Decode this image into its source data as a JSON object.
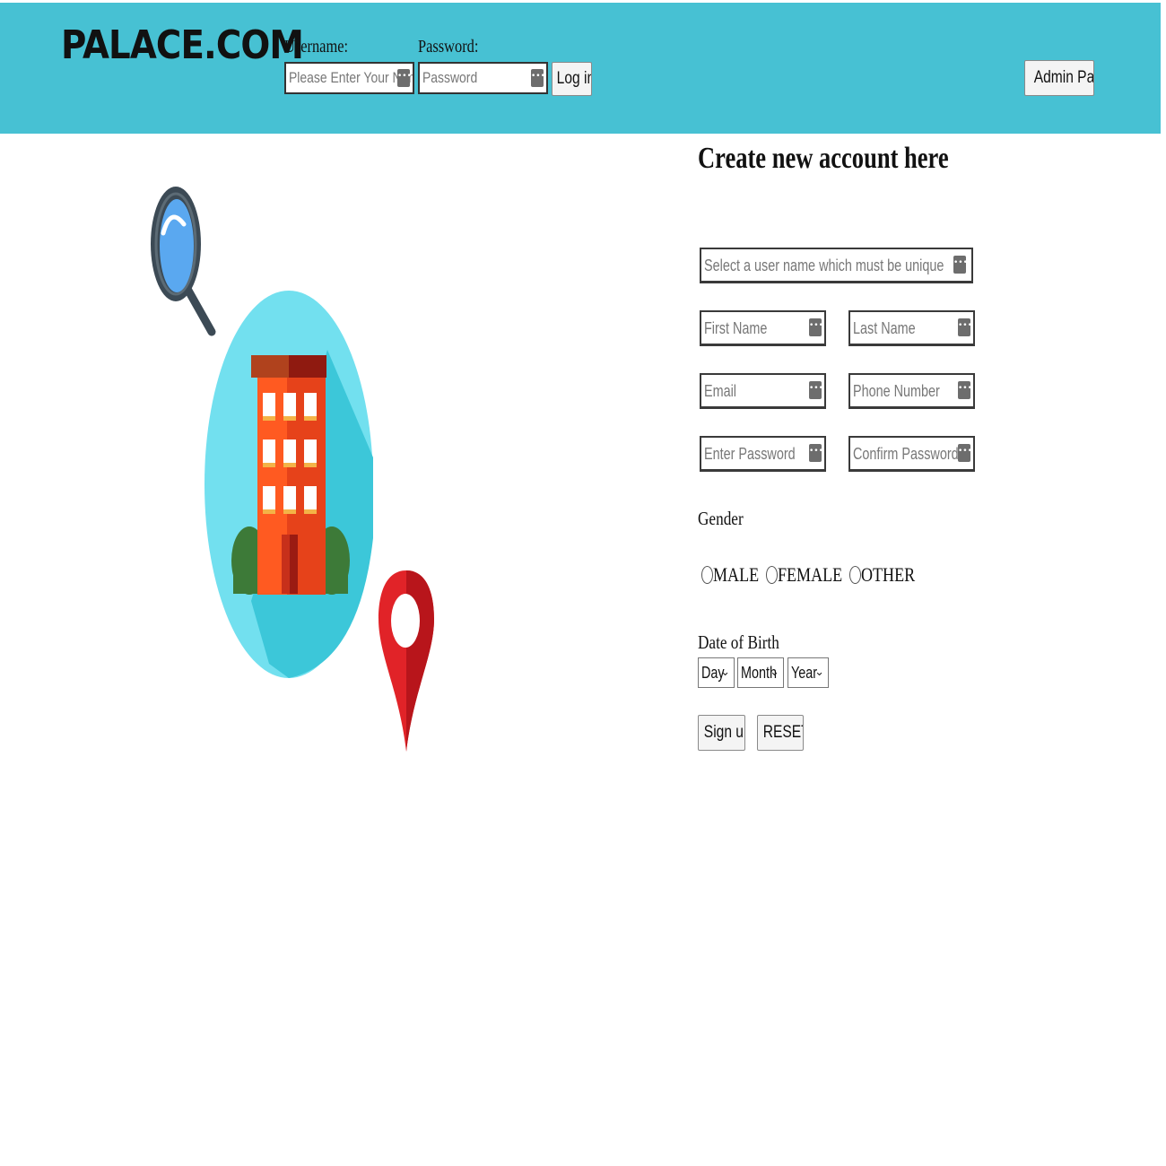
{
  "header": {
    "logo": "PALACE.COM",
    "username_label": "Username:",
    "username_placeholder": "Please Enter Your Name",
    "password_label": "Password:",
    "password_placeholder": "Password",
    "login_label": "Log in",
    "admin_label": "Admin Panel",
    "background_color": "#47c1d3"
  },
  "form": {
    "title": "Create new account here",
    "username_placeholder": "Select a user name which must be unique",
    "first_name_placeholder": "First Name",
    "last_name_placeholder": "Last Name",
    "email_placeholder": "Email",
    "phone_placeholder": "Phone Number",
    "password_placeholder": "Enter Password",
    "confirm_password_placeholder": "Confirm Password",
    "gender_label": "Gender",
    "gender_options": [
      "MALE",
      "FEMALE",
      "OTHER"
    ],
    "dob_label": "Date of Birth",
    "dob_day": "Day",
    "dob_month": "Month",
    "dob_year": "Year",
    "signup_label": "Sign up",
    "reset_label": "RESET"
  },
  "icons": {
    "field_key_icon": "password-manager-key-icon",
    "illustration": "hotel-building-location-illustration"
  }
}
